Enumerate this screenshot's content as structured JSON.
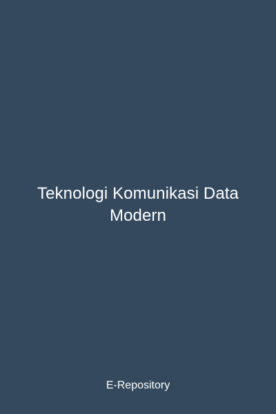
{
  "cover": {
    "title": "Teknologi Komunikasi Data Modern",
    "footer": "E-Repository",
    "background_color": "#34495e",
    "text_color": "#ffffff"
  }
}
